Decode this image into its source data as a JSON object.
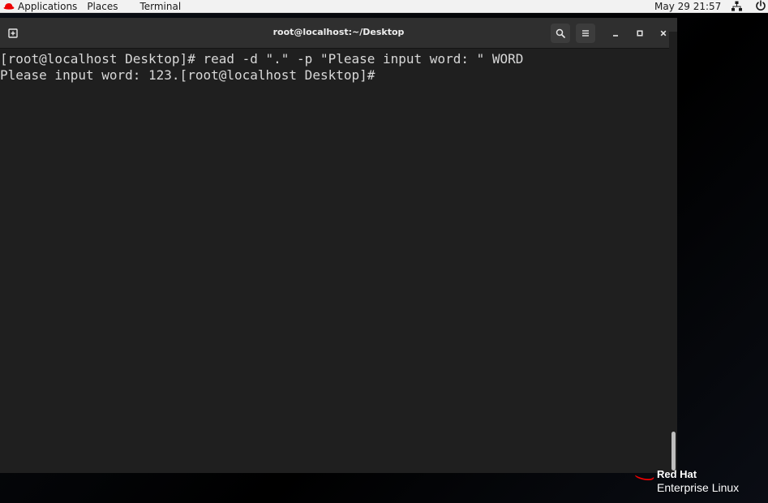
{
  "topbar": {
    "applications": "Applications",
    "places": "Places",
    "terminal": "Terminal",
    "clock": "May 29  21:57",
    "icons": [
      "redhat-hat-icon",
      "network-icon",
      "power-icon"
    ]
  },
  "window": {
    "title": "root@localhost:~/Desktop",
    "buttons": [
      "new-tab-icon",
      "search-icon",
      "hamburger-menu-icon",
      "minimize-icon",
      "maximize-icon",
      "close-icon"
    ]
  },
  "terminal": {
    "lines": [
      "[root@localhost Desktop]# read -d \".\" -p \"Please input word: \" WORD",
      "Please input word: 123.[root@localhost Desktop]# "
    ]
  },
  "branding": {
    "brand": "Red Hat",
    "product": "Enterprise Linux"
  },
  "colors": {
    "terminal_bg": "#1f1f1f",
    "titlebar_bg": "#2f2f2f",
    "text": "#d8d8d8",
    "redhat_red": "#ee0000",
    "topbar_bg": "#f2f2f2"
  }
}
